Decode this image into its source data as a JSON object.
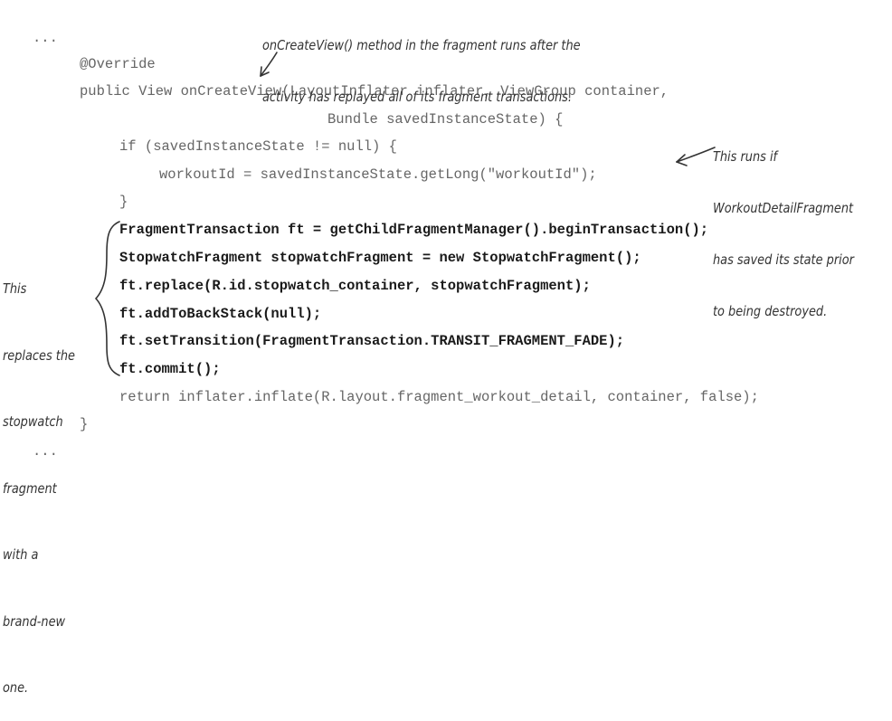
{
  "code": {
    "ellipsis_top": "...",
    "line_override": "@Override",
    "line_signature_1": "public View onCreateView(LayoutInflater inflater, ViewGroup container,",
    "line_signature_2": "Bundle savedInstanceState) {",
    "line_if": "if (savedInstanceState != null) {",
    "line_workoutid": "workoutId = savedInstanceState.getLong(\"workoutId\");",
    "line_close_if": "}",
    "line_ft": "FragmentTransaction ft = getChildFragmentManager().beginTransaction();",
    "line_stopwatch": "StopwatchFragment stopwatchFragment = new StopwatchFragment();",
    "line_replace": "ft.replace(R.id.stopwatch_container, stopwatchFragment);",
    "line_backstack": "ft.addToBackStack(null);",
    "line_transition": "ft.setTransition(FragmentTransaction.TRANSIT_FRAGMENT_FADE);",
    "line_commit": "ft.commit();",
    "line_return": "return inflater.inflate(R.layout.fragment_workout_detail, container, false);",
    "line_close_method": "}",
    "ellipsis_bottom": "..."
  },
  "annotations": {
    "top": [
      "onCreateView() method in the fragment runs after the",
      "activity has replayed all of its fragment transactions."
    ],
    "right": [
      "This runs if",
      "WorkoutDetailFragment",
      "has saved its state prior",
      "to being destroyed."
    ],
    "left": [
      "This",
      "replaces the",
      "stopwatch",
      "fragment",
      "with a",
      "brand-new",
      "one."
    ]
  }
}
